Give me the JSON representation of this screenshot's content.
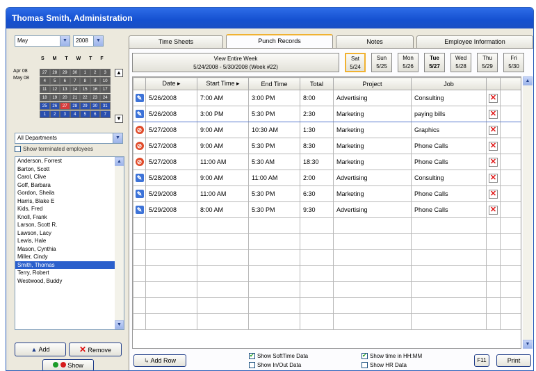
{
  "window": {
    "title": "Thomas Smith, Administration"
  },
  "left": {
    "month": "May",
    "year": "2008",
    "calendar": {
      "header": "S M T W T F",
      "month_labels": [
        "Apr 08",
        "May 08"
      ],
      "rows": [
        [
          "27",
          "28",
          "29",
          "30",
          "1",
          "2",
          "3"
        ],
        [
          "4",
          "5",
          "6",
          "7",
          "8",
          "9",
          "10"
        ],
        [
          "11",
          "12",
          "13",
          "14",
          "15",
          "16",
          "17"
        ],
        [
          "18",
          "19",
          "20",
          "21",
          "22",
          "23",
          "24"
        ],
        [
          "25",
          "26",
          "27",
          "28",
          "29",
          "30",
          "31"
        ],
        [
          "1",
          "2",
          "3",
          "4",
          "5",
          "6",
          "7"
        ]
      ]
    },
    "department": "All Departments",
    "show_terminated": "Show terminated employees",
    "employees": [
      "Anderson, Forrest",
      "Barton, Scott",
      "Carol, Clive",
      "Goff, Barbara",
      "Gordon, Sheila",
      "Harris, Blake E",
      "Kids, Fred",
      "Knoll, Frank",
      "Larson, Scott R.",
      "Lawson, Lacy",
      "Lewis, Hale",
      "Mason, Cynthia",
      "Miller, Cindy",
      "Smith, Thomas",
      "Terry, Robert",
      "Westwood, Buddy"
    ],
    "selected_employee": "Smith, Thomas",
    "add_label": "Add",
    "remove_label": "Remove",
    "show_label": "Show"
  },
  "tabs": [
    "Time Sheets",
    "Punch Records",
    "Notes",
    "Employee Information"
  ],
  "active_tab": "Punch Records",
  "week": {
    "line1": "View Entire Week",
    "line2": "5/24/2008 - 5/30/2008 (Week #22)",
    "days": [
      {
        "name": "Sat",
        "date": "5/24"
      },
      {
        "name": "Sun",
        "date": "5/25"
      },
      {
        "name": "Mon",
        "date": "5/26"
      },
      {
        "name": "Tue",
        "date": "5/27"
      },
      {
        "name": "Wed",
        "date": "5/28"
      },
      {
        "name": "Thu",
        "date": "5/29"
      },
      {
        "name": "Fri",
        "date": "5/30"
      }
    ]
  },
  "grid": {
    "columns": [
      "Date",
      "Start Time",
      "End Time",
      "Total",
      "Project",
      "Job"
    ],
    "rows": [
      {
        "status": "blue",
        "date": "5/26/2008",
        "start": "7:00 AM",
        "end": "3:00 PM",
        "total": "8:00",
        "project": "Advertising",
        "job": "Consulting"
      },
      {
        "status": "blue",
        "date": "5/26/2008",
        "start": "3:00 PM",
        "end": "5:30 PM",
        "total": "2:30",
        "project": "Marketing",
        "job": "paying bills"
      },
      {
        "status": "red",
        "date": "5/27/2008",
        "start": "9:00 AM",
        "end": "10:30 AM",
        "total": "1:30",
        "project": "Marketing",
        "job": "Graphics"
      },
      {
        "status": "red",
        "date": "5/27/2008",
        "start": "9:00 AM",
        "end": "5:30 PM",
        "total": "8:30",
        "project": "Marketing",
        "job": "Phone Calls"
      },
      {
        "status": "red",
        "date": "5/27/2008",
        "start": "11:00 AM",
        "end": "5:30 AM",
        "total": "18:30",
        "project": "Marketing",
        "job": "Phone Calls"
      },
      {
        "status": "blue",
        "date": "5/28/2008",
        "start": "9:00 AM",
        "end": "11:00 AM",
        "total": "2:00",
        "project": "Advertising",
        "job": "Consulting"
      },
      {
        "status": "blue",
        "date": "5/29/2008",
        "start": "11:00 AM",
        "end": "5:30 PM",
        "total": "6:30",
        "project": "Marketing",
        "job": "Phone Calls"
      },
      {
        "status": "blue",
        "date": "5/29/2008",
        "start": "8:00 AM",
        "end": "5:30 PM",
        "total": "9:30",
        "project": "Advertising",
        "job": "Phone Calls"
      }
    ]
  },
  "footer": {
    "add_row": "Add Row",
    "show_softtime": "Show SoftTime Data",
    "show_inout": "Show In/Out Data",
    "show_hhmm": "Show time in HH:MM",
    "show_hr": "Show HR Data",
    "f11": "F11",
    "print": "Print"
  },
  "colors": {
    "title_bar": "#1a56d8",
    "selection": "#2a5fcc",
    "active_tab_accent": "#f0b232"
  }
}
